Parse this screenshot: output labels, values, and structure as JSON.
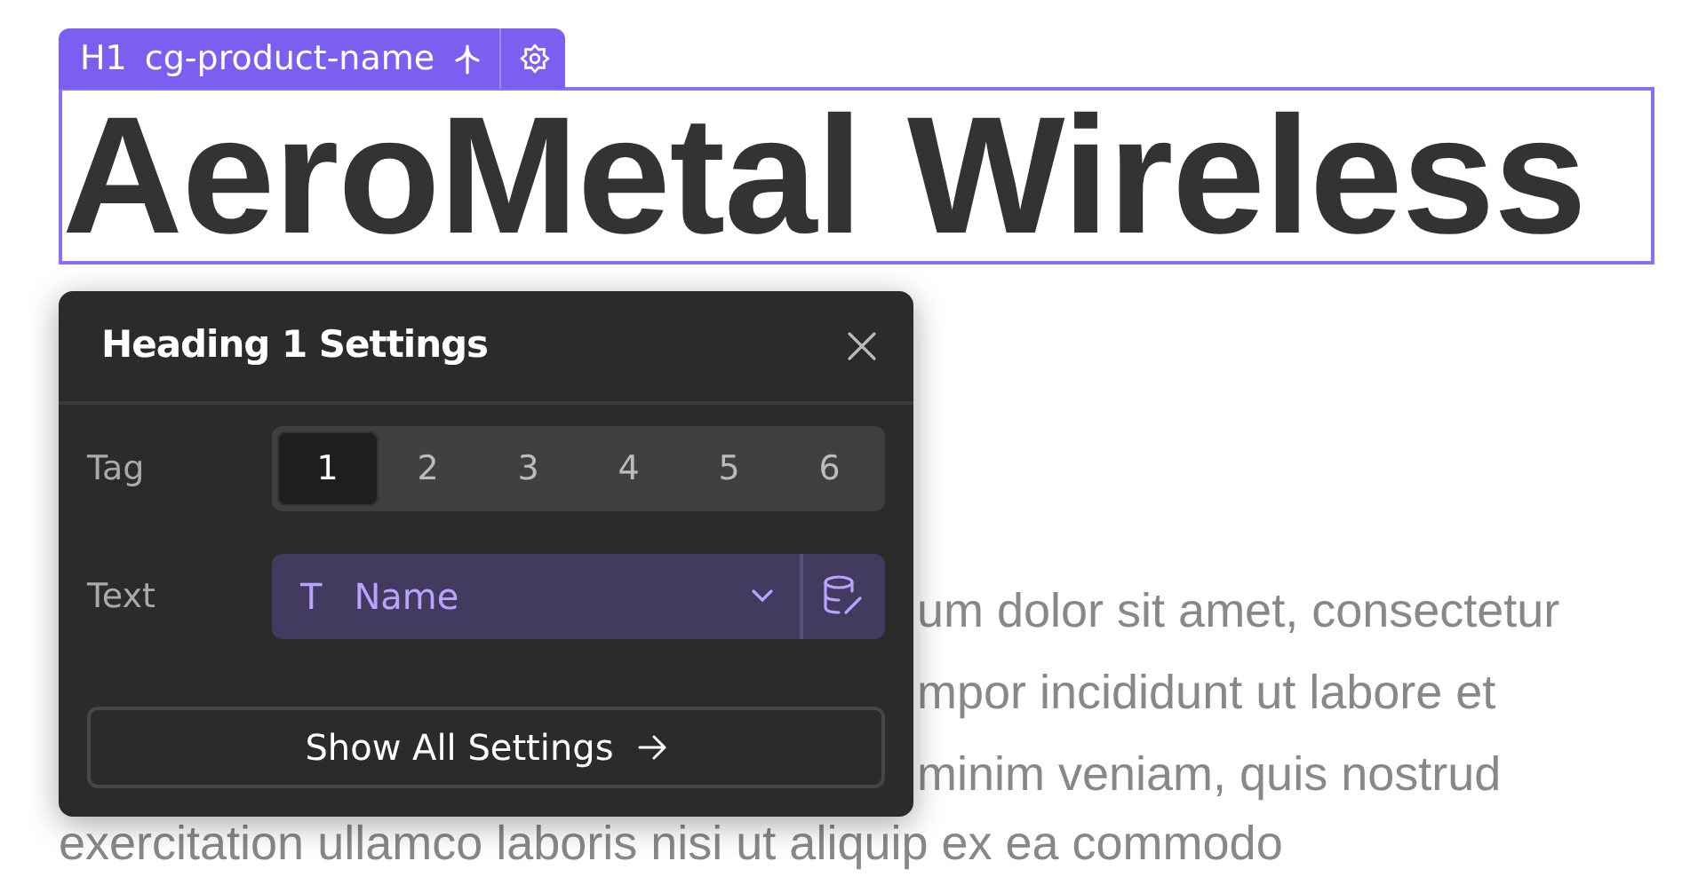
{
  "element_badge": {
    "tag": "H1",
    "class_name": "cg-product-name"
  },
  "heading": {
    "text": "AeroMetal Wireless",
    "selected": true
  },
  "paragraph": {
    "partial_lines": [
      "um dolor sit amet, consectetur",
      "mpor incididunt ut labore et",
      "minim veniam, quis nostrud"
    ],
    "last_line": "exercitation ullamco laboris nisi ut aliquip ex ea commodo"
  },
  "settings_panel": {
    "title": "Heading 1 Settings",
    "rows": [
      {
        "kind": "segmented",
        "label": "Tag",
        "options": [
          {
            "label": "1",
            "selected": true
          },
          {
            "label": "2",
            "selected": false
          },
          {
            "label": "3",
            "selected": false
          },
          {
            "label": "4",
            "selected": false
          },
          {
            "label": "5",
            "selected": false
          },
          {
            "label": "6",
            "selected": false
          }
        ]
      },
      {
        "kind": "binding",
        "label": "Text",
        "type_glyph": "T",
        "value": "Name"
      }
    ],
    "footer_button": "Show All Settings"
  }
}
